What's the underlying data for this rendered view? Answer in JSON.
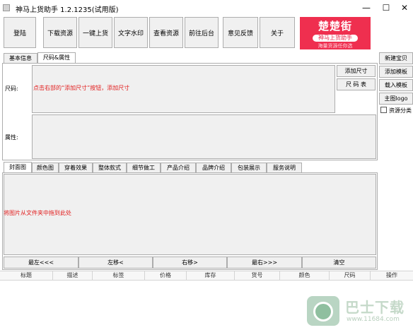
{
  "window": {
    "title": "神马上货助手 1.2.1235(试用版)",
    "controls": [
      "—",
      "☐",
      "✕"
    ]
  },
  "toolbar": [
    {
      "label": "登陆"
    },
    {
      "label": "下载资源"
    },
    {
      "label": "一键上货"
    },
    {
      "label": "文字水印"
    },
    {
      "label": "查看资源"
    },
    {
      "label": "前往后台"
    },
    {
      "label": "意见反馈"
    },
    {
      "label": "关于"
    }
  ],
  "banner": {
    "title": "楚楚街",
    "subtitle": "神马上货助手",
    "footer": "海量货源任你选"
  },
  "top_tabs": [
    "基本信息",
    "尺码&属性"
  ],
  "size_section": {
    "size_label": "尺码:",
    "size_hint": "点击右部的“添加尺寸”按钮，添加尺寸",
    "attr_label": "属性:",
    "add_size_button": "添加尺寸",
    "size_table_button": "尺 码 表"
  },
  "side_buttons": [
    "新建宝贝",
    "添加模板",
    "载入模板",
    "主图logo"
  ],
  "resource_category": {
    "label": "资源分类",
    "checked": false
  },
  "image_tabs": [
    "封面图",
    "颜色图",
    "穿着效果",
    "整体款式",
    "细节做工",
    "产品介绍",
    "品牌介绍",
    "包装展示",
    "服务说明"
  ],
  "drop_zone": {
    "hint": "将图片从文件夹中拖到此处"
  },
  "move_buttons": [
    "最左<<<",
    "左移<",
    "右移>",
    "最右>>>",
    "清空"
  ],
  "table_columns": [
    "标题",
    "描述",
    "标签",
    "价格",
    "库存",
    "货号",
    "颜色",
    "尺码",
    "操作"
  ],
  "watermark": {
    "text": "巴士下载",
    "url": "www.11684.com"
  }
}
